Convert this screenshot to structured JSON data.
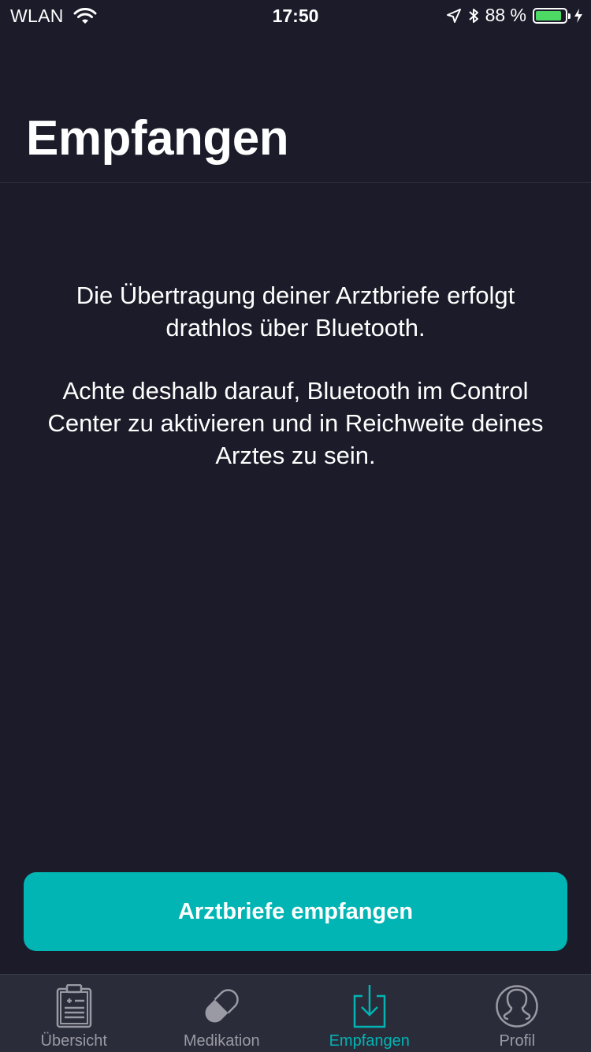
{
  "status_bar": {
    "carrier": "WLAN",
    "time": "17:50",
    "battery_text": "88 %",
    "battery_level": 0.88,
    "battery_color": "#4cd964"
  },
  "header": {
    "title": "Empfangen"
  },
  "main": {
    "info_paragraph_1": "Die Übertragung deiner Arztbriefe erfolgt drathlos über Bluetooth.",
    "info_paragraph_2": "Achte deshalb darauf, Bluetooth im Control Center zu aktivieren und in Reichweite deines Arztes zu sein.",
    "receive_button_label": "Arztbriefe empfangen"
  },
  "tab_bar": {
    "items": [
      {
        "label": "Übersicht",
        "icon": "clipboard-icon",
        "active": false
      },
      {
        "label": "Medikation",
        "icon": "pill-icon",
        "active": false
      },
      {
        "label": "Empfangen",
        "icon": "download-icon",
        "active": true
      },
      {
        "label": "Profil",
        "icon": "profile-icon",
        "active": false
      }
    ]
  },
  "colors": {
    "background": "#1b1b29",
    "accent": "#00b5b4",
    "tab_bar_background": "#2b2c3a",
    "inactive_tab": "#9a9aa4"
  }
}
